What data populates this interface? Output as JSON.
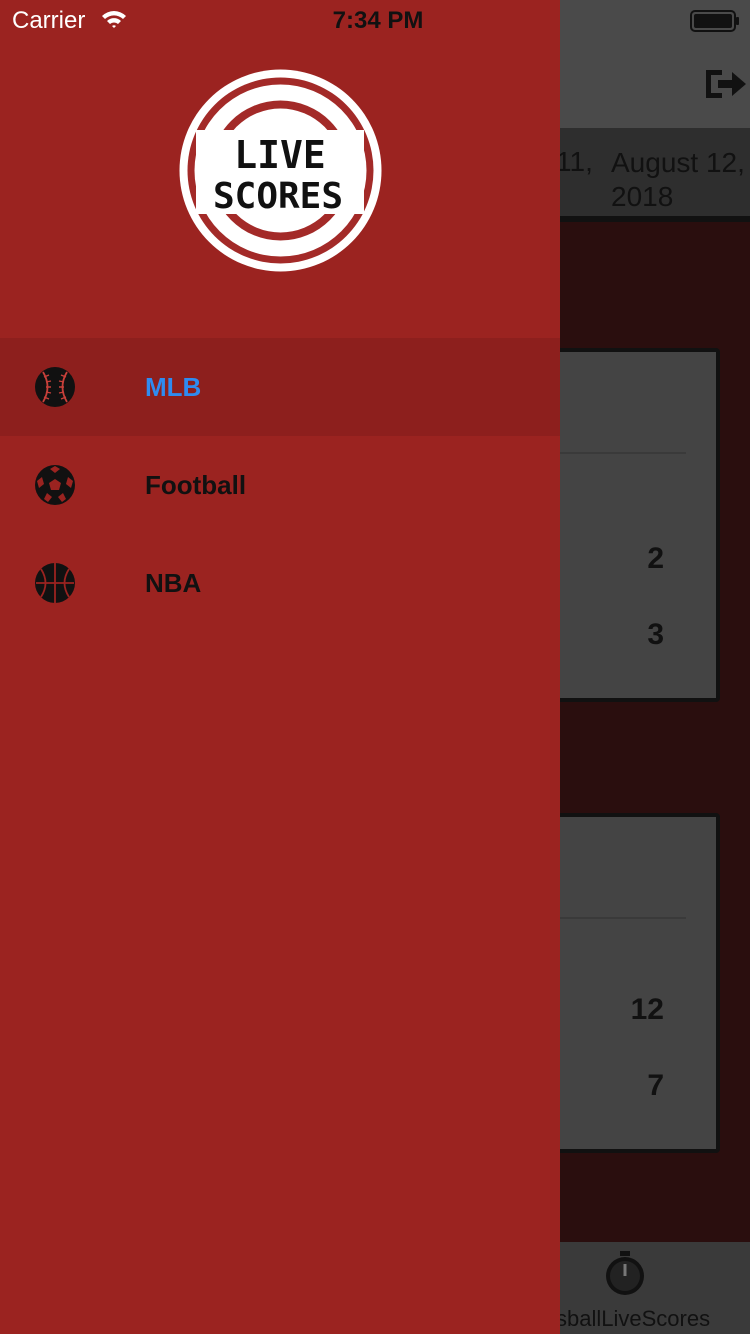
{
  "status_bar": {
    "carrier": "Carrier",
    "time": "7:34 PM",
    "icons": [
      "wifi-icon",
      "battery-icon"
    ]
  },
  "background_screen": {
    "date_prev_partial": "11,",
    "date_current": "August 12, 2018",
    "cards": [
      {
        "scores": [
          "2",
          "3"
        ]
      },
      {
        "scores": [
          "12",
          "7"
        ]
      }
    ],
    "tab_label_partial": "ssballLiveScores",
    "tab_icon": "stopwatch-icon",
    "logout_icon": "logout-icon"
  },
  "drawer": {
    "logo_text": [
      "LIVE",
      "SCORES"
    ],
    "items": [
      {
        "label": "MLB",
        "icon": "baseball-icon",
        "active": true
      },
      {
        "label": "Football",
        "icon": "soccer-ball-icon",
        "active": false
      },
      {
        "label": "NBA",
        "icon": "basketball-icon",
        "active": false
      }
    ]
  },
  "colors": {
    "drawer_bg": "#9b2320",
    "active_item_bg": "#8d1f1d",
    "active_label": "#2f8bf0"
  }
}
